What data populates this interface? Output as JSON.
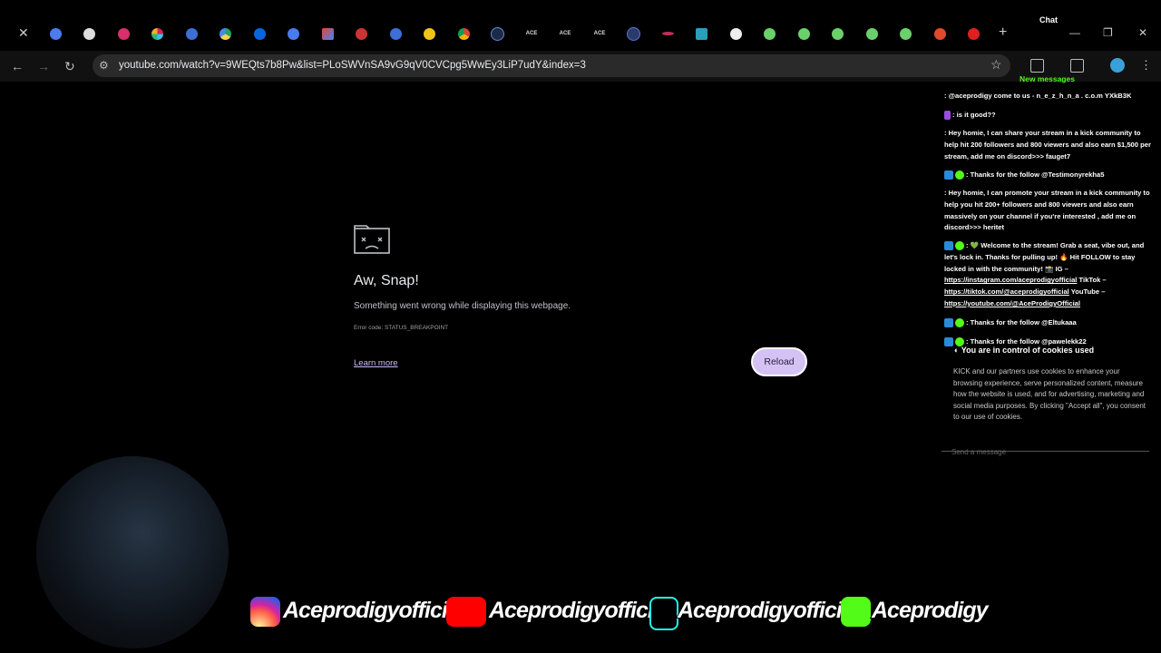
{
  "browser": {
    "chat_label": "Chat",
    "url": "youtube.com/watch?v=9WEQts7b8Pw&list=PLoSWVnSA9vG9qV0CVCpg5WwEy3LiP7udY&index=3",
    "tab_texts": [
      "ACE",
      "ACE",
      "ACE"
    ]
  },
  "error_page": {
    "title": "Aw, Snap!",
    "message": "Something went wrong while displaying this webpage.",
    "error_code": "Error code: STATUS_BREAKPOINT",
    "learn_more": "Learn more",
    "reload": "Reload"
  },
  "chat": {
    "new_messages": "New messages",
    "messages": [
      ": @aceprodigy come to us - n_e_z_h_n_a . c.o.m YXkB3K",
      ": is it good??",
      ": Hey homie, I can share your stream in a kick community to help hit 200 followers and 800 viewers and also earn $1,500 per stream, add me on discord>>> fauget7",
      ": Thanks for the follow @Testimonyrekha5",
      ": Hey homie, I can promote your stream in a kick community to help you hit 200+ followers and 800 viewers and also earn massively on your channel if you're interested , add me on discord>>> heritet",
      ": 💚 Welcome to the stream! Grab a seat, vibe out, and let's lock in. Thanks for pulling up! 🔥 Hit FOLLOW to stay locked in with the community! 📸 IG –",
      "https://instagram.com/aceprodigyofficial",
      "TikTok –",
      "https://tiktok.com/@aceprodigyofficial",
      "YouTube –",
      "https://youtube.com/@AceProdigyOfficial",
      ": Thanks for the follow @Eltukaaa",
      ": Thanks for the follow @pawelekk22"
    ],
    "cookie_title": "You are in control of cookies used",
    "cookie_body": "KICK and our partners use cookies to enhance your browsing experience, serve personalized content, measure how the website is used, and for advertising, marketing and social media purposes. By clicking \"Accept all\", you consent to our use of cookies.",
    "send_placeholder": "Send a message"
  },
  "socials": {
    "instagram": "Aceprodigyofficial",
    "youtube": "Aceprodigyofficial",
    "tiktok": "Aceprodigyofficial",
    "kick": "Aceprodigy"
  },
  "colors": {
    "accent_green": "#53fc18",
    "reload_bg": "#d5c2f5",
    "link": "#c8b8ff"
  }
}
